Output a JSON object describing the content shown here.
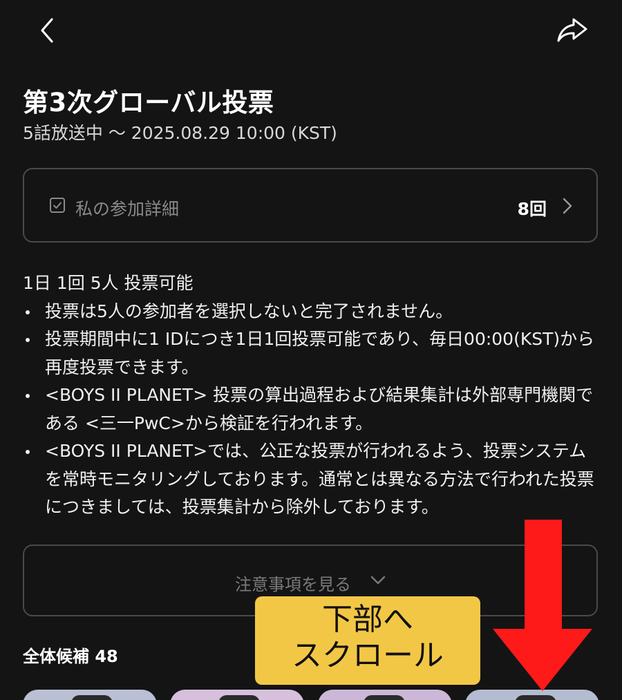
{
  "header": {
    "back_icon": "chevron-left-icon",
    "share_icon": "share-arrow-icon"
  },
  "vote": {
    "title": "第3次グローバル投票",
    "period": "5話放送中 〜 2025.08.29 10:00 (KST)"
  },
  "participation": {
    "icon": "checkbox-icon",
    "label": "私の参加詳細",
    "count": "8回"
  },
  "rules": {
    "headline": "1日 1回 5人 投票可能",
    "items": [
      "投票は5人の参加者を選択しないと完了されません。",
      "投票期間中に1 IDにつき1日1回投票可能であり、毎日00:00(KST)から再度投票できます。",
      "<BOYS II PLANET> 投票の算出過程および結果集計は外部専門機関である <三一PwC>から検証を行われます。",
      "<BOYS II PLANET>では、公正な投票が行われるよう、投票システムを常時モニタリングしております。通常とは異なる方法で行われた投票につきましては、投票集計から除外しております。"
    ]
  },
  "notice": {
    "label": "注意事項を見る"
  },
  "candidates": {
    "title": "全体候補 48",
    "thumb_colors": [
      "#b9c0d4",
      "#d6c0dc",
      "#cbb8d8",
      "#b3bcd0"
    ]
  },
  "overlay": {
    "line1": "下部へ",
    "line2": "スクロール",
    "callout_color": "#f3c746",
    "arrow_color": "#ff1a1a"
  }
}
